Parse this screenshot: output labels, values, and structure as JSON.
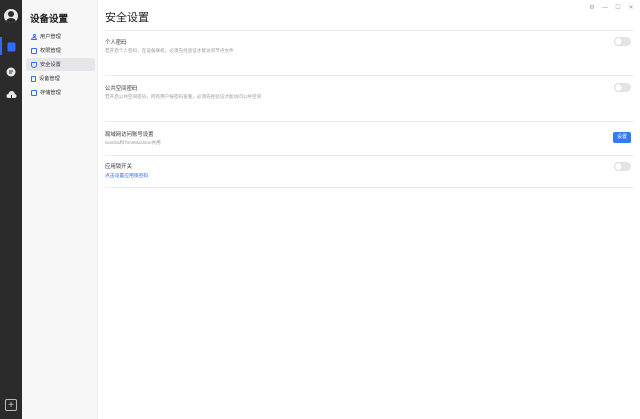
{
  "rail": {
    "icons": [
      "user-avatar-icon",
      "storage-icon",
      "chat-icon",
      "cloud-icon",
      "add-icon"
    ],
    "accent": "#2f6bff"
  },
  "sidebar": {
    "title": "设备设置",
    "items": [
      {
        "label": "用户管理",
        "icon": "user-icon"
      },
      {
        "label": "权限管理",
        "icon": "permission-icon"
      },
      {
        "label": "安全设置",
        "icon": "shield-icon",
        "active": true
      },
      {
        "label": "设备管理",
        "icon": "device-icon"
      },
      {
        "label": "存储管理",
        "icon": "storage-icon"
      }
    ]
  },
  "main": {
    "title": "安全设置",
    "window_controls": [
      "⚙",
      "—",
      "☐",
      "✕"
    ],
    "sections": [
      {
        "label": "个人密码",
        "desc": "若开启个人密码，在设备联机，必须先经验证才能访问节点文件",
        "control": "toggle",
        "on": false
      },
      {
        "label": "公共空间密码",
        "desc": "若开启公共空间密码，所有用户按密码查看，必须先经验证才能访问公共空间",
        "control": "toggle",
        "on": false
      },
      {
        "label": "局域网访问账号设置",
        "desc": "Samba和TimeMachine共用",
        "control": "button",
        "button_label": "设置"
      },
      {
        "label": "应用锁开关",
        "link": "点击设置应用锁密码",
        "control": "toggle",
        "on": false
      }
    ]
  },
  "colors": {
    "primary_button": "#2f7cf6",
    "link": "#2f6bff",
    "toggle_off": "#e4e4e6"
  }
}
